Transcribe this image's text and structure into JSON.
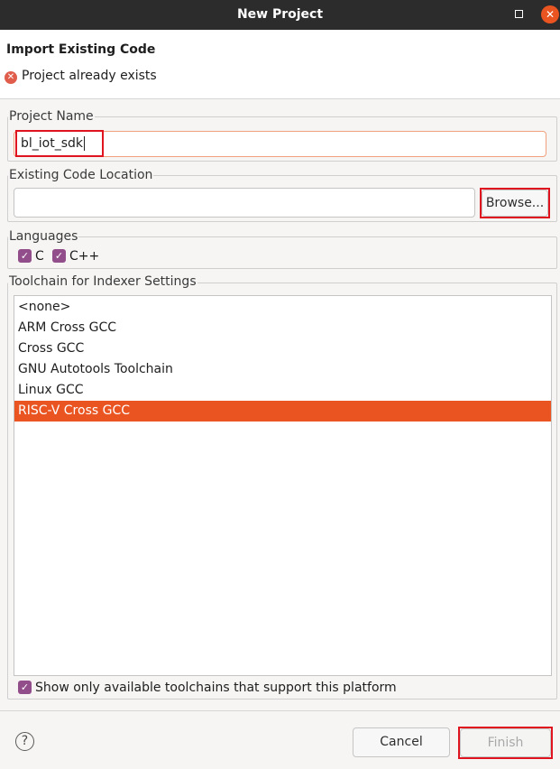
{
  "window": {
    "title": "New Project"
  },
  "header": {
    "heading": "Import Existing Code",
    "error_message": "Project already exists"
  },
  "project_name": {
    "label": "Project Name",
    "value": "bl_iot_sdk"
  },
  "code_location": {
    "label": "Existing Code Location",
    "value": "",
    "browse_label": "Browse..."
  },
  "languages": {
    "label": "Languages",
    "c_label": "C",
    "c_checked": true,
    "cpp_label": "C++",
    "cpp_checked": true
  },
  "toolchain": {
    "label": "Toolchain for Indexer Settings",
    "items": [
      "<none>",
      "ARM Cross GCC",
      "Cross GCC",
      "GNU Autotools Toolchain",
      "Linux GCC",
      "RISC-V Cross GCC"
    ],
    "selected": "RISC-V Cross GCC",
    "filter_label": "Show only available toolchains that support this platform",
    "filter_checked": true
  },
  "footer": {
    "cancel_label": "Cancel",
    "finish_label": "Finish",
    "finish_enabled": false
  },
  "colors": {
    "accent": "#e95420",
    "checkbox": "#924d8b",
    "highlight_box": "#e0141e"
  },
  "icons": {
    "error": "error-circle-icon",
    "help": "help-icon",
    "minimize": "minimize-icon",
    "close": "close-icon",
    "check": "checkmark-icon"
  }
}
